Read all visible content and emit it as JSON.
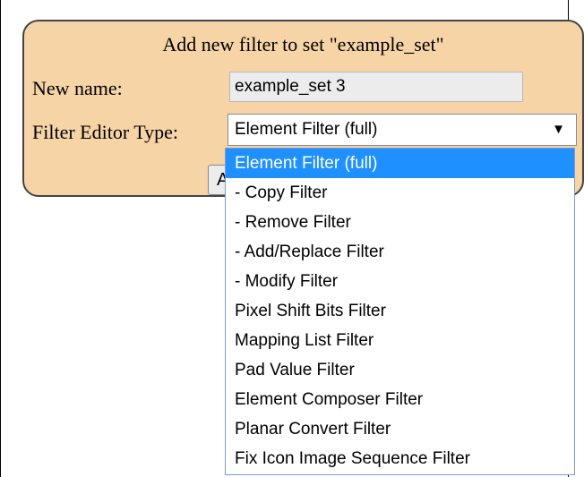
{
  "dialog": {
    "title": "Add new filter to set \"example_set\"",
    "new_name_label": "New name:",
    "new_name_value": "example_set 3",
    "editor_type_label": "Filter Editor Type:",
    "editor_type_selected": "Element Filter (full)",
    "dropdown_arrow_icon": "caret-down-icon",
    "add_button_visible_text": "A"
  },
  "dropdown": {
    "options": [
      "Element Filter (full)",
      "- Copy Filter",
      "- Remove Filter",
      "- Add/Replace Filter",
      "- Modify Filter",
      "Pixel Shift Bits Filter",
      "Mapping List Filter",
      "Pad Value Filter",
      "Element Composer Filter",
      "Planar Convert Filter",
      "Fix Icon Image Sequence Filter"
    ],
    "highlighted_index": 0
  },
  "colors": {
    "panel_background": "#f6d4a6",
    "highlight": "#1e90ff"
  }
}
